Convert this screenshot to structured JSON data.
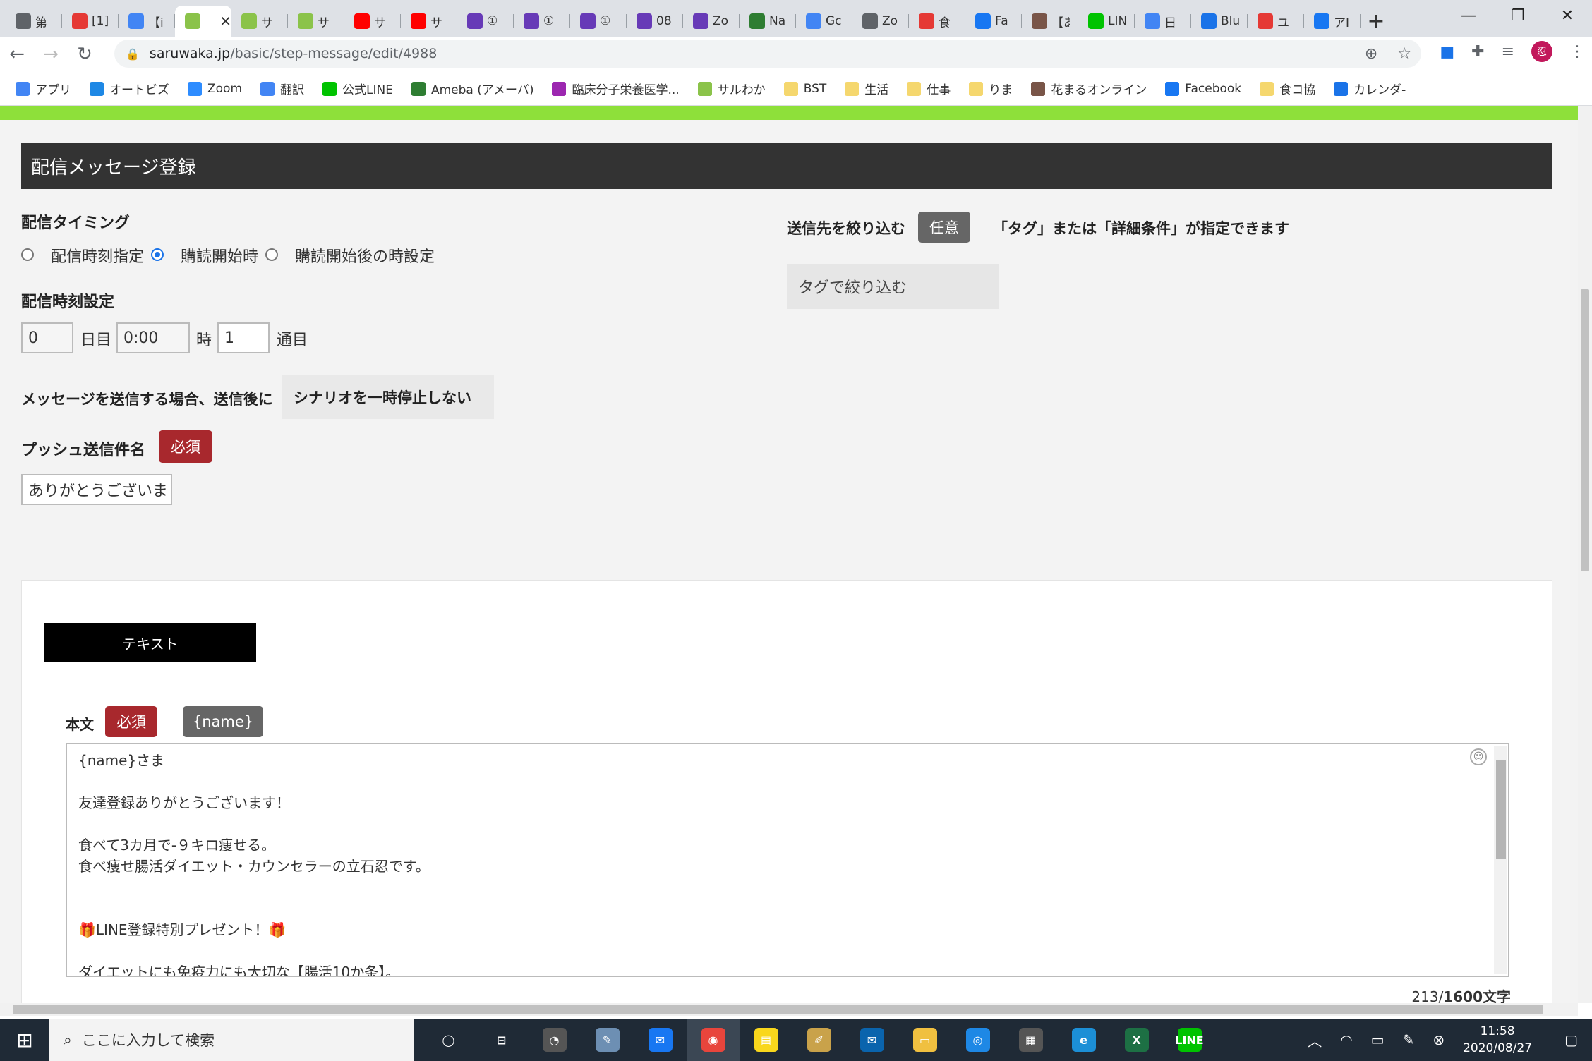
{
  "browser": {
    "tabs": [
      {
        "title": "第",
        "color": "#5f6368"
      },
      {
        "title": "[1]",
        "color": "#e53935"
      },
      {
        "title": "【i",
        "color": "#4285f4"
      },
      {
        "title": "",
        "color": "#8bc34a"
      },
      {
        "title": "サ",
        "color": "#8bc34a"
      },
      {
        "title": "サ",
        "color": "#8bc34a"
      },
      {
        "title": "サ",
        "color": "#ff0000"
      },
      {
        "title": "サ",
        "color": "#ff0000"
      },
      {
        "title": "①",
        "color": "#673ab7"
      },
      {
        "title": "①",
        "color": "#673ab7"
      },
      {
        "title": "①",
        "color": "#673ab7"
      },
      {
        "title": "08",
        "color": "#673ab7"
      },
      {
        "title": "Zo",
        "color": "#673ab7"
      },
      {
        "title": "Na",
        "color": "#2e7d32"
      },
      {
        "title": "Gc",
        "color": "#4285f4"
      },
      {
        "title": "Zo",
        "color": "#5f6368"
      },
      {
        "title": "食",
        "color": "#e53935"
      },
      {
        "title": "Fa",
        "color": "#1877f2"
      },
      {
        "title": "【あ",
        "color": "#795548"
      },
      {
        "title": "LIN",
        "color": "#00c300"
      },
      {
        "title": "日",
        "color": "#4285f4"
      },
      {
        "title": "Blu",
        "color": "#1a73e8"
      },
      {
        "title": "ユ",
        "color": "#e53935"
      },
      {
        "title": "アI",
        "color": "#1877f2"
      }
    ],
    "active_tab_index": 3,
    "url_host": "saruwaka.jp",
    "url_path": "/basic/step-message/edit/4988",
    "avatar_letter": "忍",
    "bookmarks": [
      {
        "label": "アプリ",
        "color": "#4285f4"
      },
      {
        "label": "オートビズ",
        "color": "#1e88e5"
      },
      {
        "label": "Zoom",
        "color": "#2d8cff"
      },
      {
        "label": "翻訳",
        "color": "#4285f4"
      },
      {
        "label": "公式LINE",
        "color": "#00c300"
      },
      {
        "label": "Ameba (アメーバ)",
        "color": "#2e7d32"
      },
      {
        "label": "臨床分子栄養医学...",
        "color": "#9c27b0"
      },
      {
        "label": "サルわか",
        "color": "#8bc34a"
      },
      {
        "label": "BST",
        "color": "#f5d76e"
      },
      {
        "label": "生活",
        "color": "#f5d76e"
      },
      {
        "label": "仕事",
        "color": "#f5d76e"
      },
      {
        "label": "りま",
        "color": "#f5d76e"
      },
      {
        "label": "花まるオンライン",
        "color": "#795548"
      },
      {
        "label": "Facebook",
        "color": "#1877f2"
      },
      {
        "label": "食コ協",
        "color": "#f5d76e"
      },
      {
        "label": "カレンダ-",
        "color": "#1a73e8"
      }
    ]
  },
  "page": {
    "heading": "配信メッセージ登録",
    "timing": {
      "label": "配信タイミング",
      "options": [
        "配信時刻指定",
        "購読開始時",
        "購読開始後の時設定"
      ],
      "selected_index": 1
    },
    "time_setting": {
      "label": "配信時刻設定",
      "day_value": "0",
      "day_unit": "日目",
      "time_value": "0:00",
      "time_unit": "時",
      "count_value": "1",
      "count_unit": "通目"
    },
    "pause": {
      "label": "メッセージを送信する場合、送信後に",
      "value": "シナリオを一時停止しない"
    },
    "push_title": {
      "label": "プッシュ送信件名",
      "required": "必須",
      "value": "ありがとうございま"
    },
    "filter": {
      "label": "送信先を絞り込む",
      "badge": "任意",
      "note": "「タグ」または「詳細条件」が指定できます",
      "tag_button": "タグで絞り込む"
    },
    "editor": {
      "tab_label": "テキスト",
      "body_label": "本文",
      "required": "必須",
      "name_button": "{name}",
      "lines": [
        "{name}さま",
        "",
        "友達登録ありがとうございます！",
        "",
        "食べて3カ月で-９キロ痩せる。",
        "食べ痩せ腸活ダイエット・カウンセラーの立石忍です。",
        "",
        "",
        "🎁LINE登録特別プレゼント！🎁",
        "",
        "ダイエットにも免疫力にも大切な【腸活10か条】。"
      ],
      "count": "213",
      "limit": "1600文字"
    }
  },
  "taskbar": {
    "search_placeholder": "ここに入力して検索",
    "time": "11:58",
    "date": "2020/08/27",
    "apps": [
      {
        "name": "task-view",
        "label": "◯",
        "color": "transparent"
      },
      {
        "name": "timeline",
        "label": "⊟",
        "color": "transparent"
      },
      {
        "name": "clock-app",
        "label": "◔",
        "color": "#555"
      },
      {
        "name": "paint-app",
        "label": "✎",
        "color": "#6d8fb3"
      },
      {
        "name": "messenger",
        "label": "✉",
        "color": "#1877f2"
      },
      {
        "name": "chrome",
        "label": "◉",
        "color": "#e8453c"
      },
      {
        "name": "sticky-notes",
        "label": "▤",
        "color": "#f9d71c"
      },
      {
        "name": "notes-app",
        "label": "✐",
        "color": "#c9a24a"
      },
      {
        "name": "mail",
        "label": "✉",
        "color": "#0a64ad"
      },
      {
        "name": "file-explorer",
        "label": "▭",
        "color": "#f0c040"
      },
      {
        "name": "instagram",
        "label": "◎",
        "color": "#1e88e5"
      },
      {
        "name": "store",
        "label": "▦",
        "color": "#555"
      },
      {
        "name": "edge",
        "label": "e",
        "color": "#1c8fd6"
      },
      {
        "name": "excel",
        "label": "X",
        "color": "#1d7044"
      },
      {
        "name": "line",
        "label": "LINE",
        "color": "#00c300"
      }
    ]
  }
}
